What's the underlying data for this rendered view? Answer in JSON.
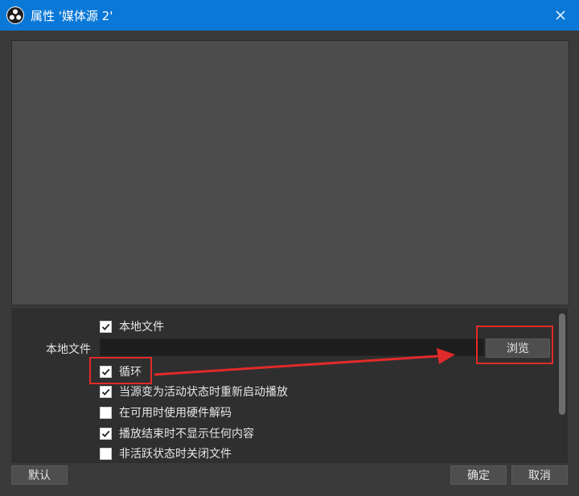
{
  "window": {
    "title": "属性 '媒体源 2'",
    "close_label": "×"
  },
  "colors": {
    "titlebar": "#0a78d7",
    "background": "#3a3a3a",
    "preview": "#4c4c4c",
    "annotation": "#e12a2a"
  },
  "icons": {
    "app": "obs-logo-icon",
    "close": "close-icon",
    "check": "check-icon"
  },
  "properties": {
    "local_file_checkbox": {
      "label": "本地文件",
      "checked": true
    },
    "local_file_field_label": "本地文件",
    "local_file_value": "",
    "browse_button": "浏览",
    "loop": {
      "label": "循环",
      "checked": true
    },
    "restart_on_active": {
      "label": "当源变为活动状态时重新启动播放",
      "checked": true
    },
    "hw_decode": {
      "label": "在可用时使用硬件解码",
      "checked": false
    },
    "hide_on_end": {
      "label": "播放结束时不显示任何内容",
      "checked": true
    },
    "close_when_inactive": {
      "label": "非活跃状态时关闭文件",
      "checked": false
    }
  },
  "footer": {
    "defaults_button": "默认",
    "ok_button": "确定",
    "cancel_button": "取消"
  }
}
